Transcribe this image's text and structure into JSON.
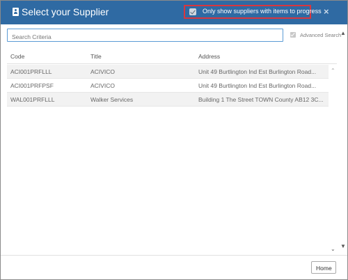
{
  "dialog": {
    "title": "Select your Supplier",
    "filter_label": "Only show suppliers with items to progress",
    "filter_checked": true,
    "close_glyph": "×"
  },
  "search": {
    "placeholder": "Search Criteria",
    "value": "",
    "advanced_label": "Advanced Search"
  },
  "table": {
    "columns": [
      "Code",
      "Title",
      "Address"
    ],
    "rows": [
      {
        "code": "ACI001PRFLLL",
        "title": "ACIVICO",
        "address": "Unit 49 Burtlington Ind Est Burlington Road..."
      },
      {
        "code": "ACI001PRFPSF",
        "title": "ACIVICO",
        "address": "Unit 49 Burtlington Ind Est Burlington Road..."
      },
      {
        "code": "WAL001PRFLLL",
        "title": "Walker Services",
        "address": "Building 1 The Street TOWN County AB12 3C..."
      }
    ]
  },
  "footer": {
    "home_label": "Home"
  },
  "colors": {
    "header": "#2f6aa3",
    "highlight_border": "#d9363e",
    "input_border": "#5b9bd5"
  },
  "icons": {
    "title": "user-card-icon",
    "close": "close-icon",
    "scroll_up": "chevron-up-icon",
    "scroll_down": "chevron-down-icon"
  }
}
